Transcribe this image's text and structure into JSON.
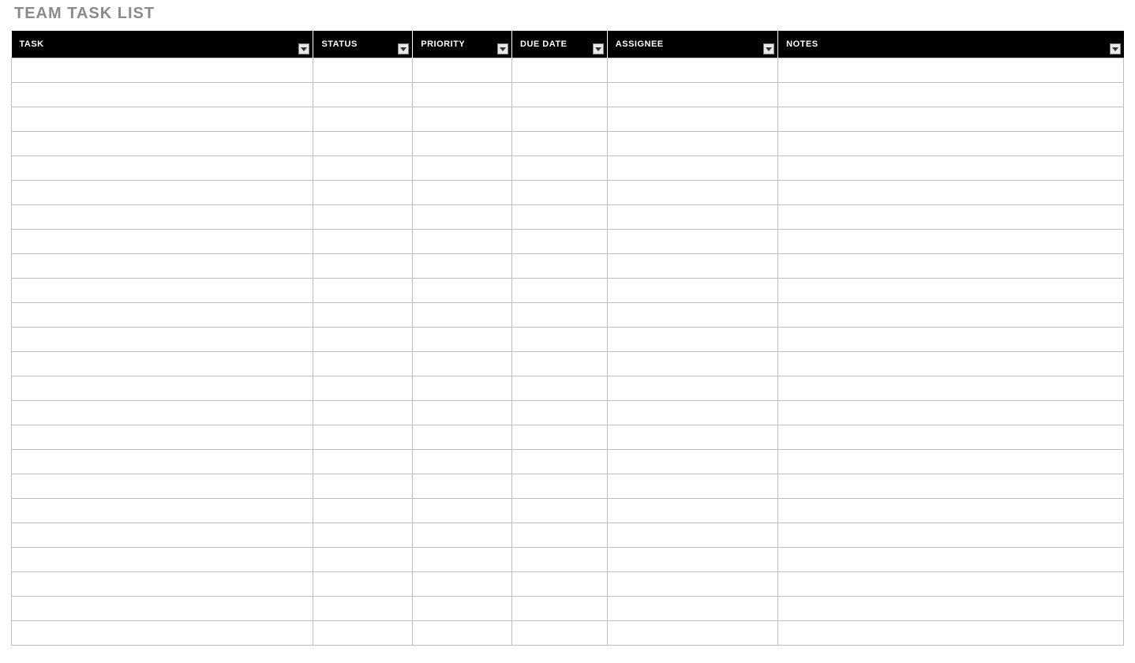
{
  "title": "TEAM TASK LIST",
  "columns": [
    {
      "key": "task",
      "label": "TASK",
      "filter": true
    },
    {
      "key": "status",
      "label": "STATUS",
      "filter": true
    },
    {
      "key": "priority",
      "label": "PRIORITY",
      "filter": true
    },
    {
      "key": "duedate",
      "label": "DUE DATE",
      "filter": true
    },
    {
      "key": "assignee",
      "label": "ASSIGNEE",
      "filter": true
    },
    {
      "key": "notes",
      "label": "NOTES",
      "filter": true
    }
  ],
  "rows": [
    {
      "task": "",
      "status": "",
      "priority": "",
      "duedate": "",
      "assignee": "",
      "notes": ""
    },
    {
      "task": "",
      "status": "",
      "priority": "",
      "duedate": "",
      "assignee": "",
      "notes": ""
    },
    {
      "task": "",
      "status": "",
      "priority": "",
      "duedate": "",
      "assignee": "",
      "notes": ""
    },
    {
      "task": "",
      "status": "",
      "priority": "",
      "duedate": "",
      "assignee": "",
      "notes": ""
    },
    {
      "task": "",
      "status": "",
      "priority": "",
      "duedate": "",
      "assignee": "",
      "notes": ""
    },
    {
      "task": "",
      "status": "",
      "priority": "",
      "duedate": "",
      "assignee": "",
      "notes": ""
    },
    {
      "task": "",
      "status": "",
      "priority": "",
      "duedate": "",
      "assignee": "",
      "notes": ""
    },
    {
      "task": "",
      "status": "",
      "priority": "",
      "duedate": "",
      "assignee": "",
      "notes": ""
    },
    {
      "task": "",
      "status": "",
      "priority": "",
      "duedate": "",
      "assignee": "",
      "notes": ""
    },
    {
      "task": "",
      "status": "",
      "priority": "",
      "duedate": "",
      "assignee": "",
      "notes": ""
    },
    {
      "task": "",
      "status": "",
      "priority": "",
      "duedate": "",
      "assignee": "",
      "notes": ""
    },
    {
      "task": "",
      "status": "",
      "priority": "",
      "duedate": "",
      "assignee": "",
      "notes": ""
    },
    {
      "task": "",
      "status": "",
      "priority": "",
      "duedate": "",
      "assignee": "",
      "notes": ""
    },
    {
      "task": "",
      "status": "",
      "priority": "",
      "duedate": "",
      "assignee": "",
      "notes": ""
    },
    {
      "task": "",
      "status": "",
      "priority": "",
      "duedate": "",
      "assignee": "",
      "notes": ""
    },
    {
      "task": "",
      "status": "",
      "priority": "",
      "duedate": "",
      "assignee": "",
      "notes": ""
    },
    {
      "task": "",
      "status": "",
      "priority": "",
      "duedate": "",
      "assignee": "",
      "notes": ""
    },
    {
      "task": "",
      "status": "",
      "priority": "",
      "duedate": "",
      "assignee": "",
      "notes": ""
    },
    {
      "task": "",
      "status": "",
      "priority": "",
      "duedate": "",
      "assignee": "",
      "notes": ""
    },
    {
      "task": "",
      "status": "",
      "priority": "",
      "duedate": "",
      "assignee": "",
      "notes": ""
    },
    {
      "task": "",
      "status": "",
      "priority": "",
      "duedate": "",
      "assignee": "",
      "notes": ""
    },
    {
      "task": "",
      "status": "",
      "priority": "",
      "duedate": "",
      "assignee": "",
      "notes": ""
    },
    {
      "task": "",
      "status": "",
      "priority": "",
      "duedate": "",
      "assignee": "",
      "notes": ""
    },
    {
      "task": "",
      "status": "",
      "priority": "",
      "duedate": "",
      "assignee": "",
      "notes": ""
    }
  ]
}
